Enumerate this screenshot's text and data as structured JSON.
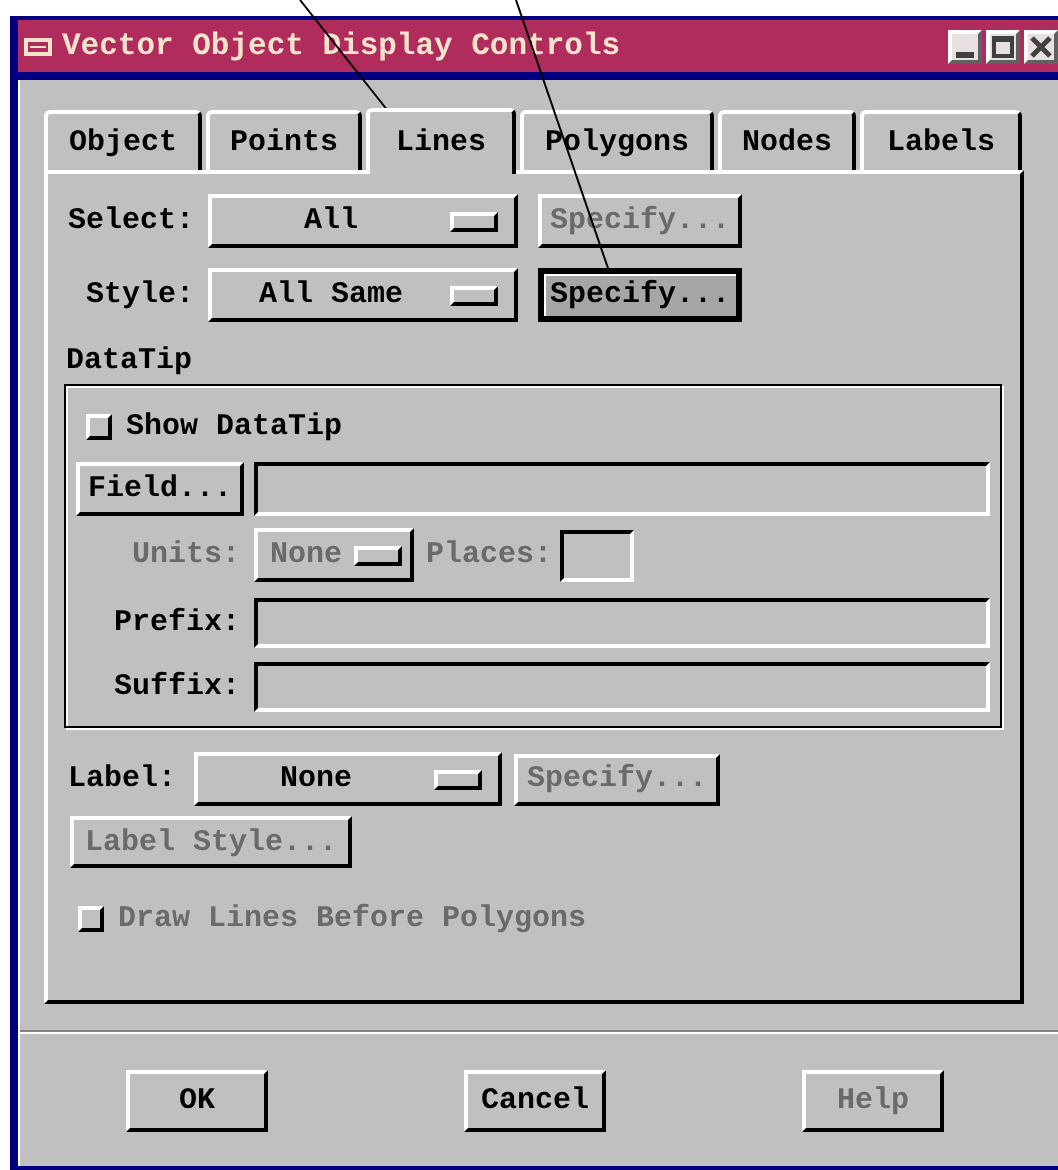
{
  "window": {
    "title": "Vector Object Display Controls"
  },
  "tabs": [
    {
      "label": "Object",
      "selected": false
    },
    {
      "label": "Points",
      "selected": false
    },
    {
      "label": "Lines",
      "selected": true
    },
    {
      "label": "Polygons",
      "selected": false
    },
    {
      "label": "Nodes",
      "selected": false
    },
    {
      "label": "Labels",
      "selected": false
    }
  ],
  "select": {
    "label": "Select:",
    "value": "All",
    "button": {
      "label": "Specify...",
      "disabled": true,
      "focused": false
    }
  },
  "style": {
    "label": "Style:",
    "value": "All Same",
    "button": {
      "label": "Specify...",
      "disabled": false,
      "focused": true
    }
  },
  "datatip": {
    "title": "DataTip",
    "show": {
      "label": "Show DataTip",
      "checked": false,
      "disabled": false
    },
    "field_button": {
      "label": "Field...",
      "disabled": false
    },
    "units": {
      "label": "Units:",
      "value": "None",
      "disabled": true
    },
    "places": {
      "label": "Places:",
      "disabled": true
    },
    "prefix": {
      "label": "Prefix:"
    },
    "suffix": {
      "label": "Suffix:"
    }
  },
  "label": {
    "label": "Label:",
    "value": "None",
    "button": {
      "label": "Specify...",
      "disabled": true,
      "focused": false
    }
  },
  "label_style": {
    "label": "Label Style...",
    "disabled": true
  },
  "draw_lines": {
    "label": "Draw Lines Before Polygons",
    "checked": false,
    "disabled": true
  },
  "buttons": [
    {
      "label": "OK",
      "disabled": false
    },
    {
      "label": "Cancel",
      "disabled": false
    },
    {
      "label": "Help",
      "disabled": true
    }
  ]
}
